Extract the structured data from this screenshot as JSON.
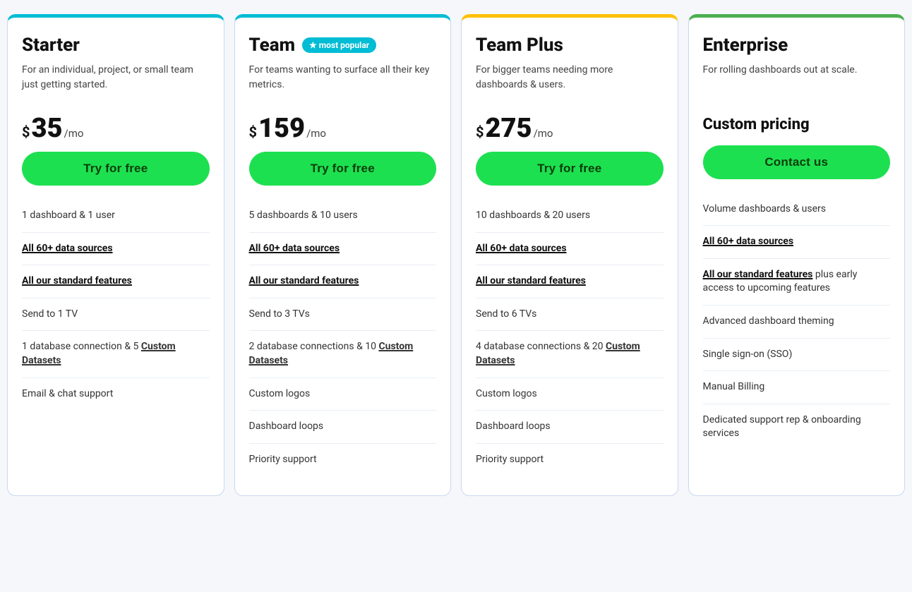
{
  "plans": [
    {
      "id": "starter",
      "name": "Starter",
      "badge": null,
      "description": "For an individual, project, or small team just getting started.",
      "price": "35",
      "period": "/mo",
      "cta": "Try for free",
      "cardClass": "starter",
      "features": [
        {
          "text": "1 dashboard & 1 user",
          "type": "plain"
        },
        {
          "text": "All 60+ data sources",
          "type": "link"
        },
        {
          "text": "All our standard features",
          "type": "link"
        },
        {
          "text": "Send to 1 TV",
          "type": "plain"
        },
        {
          "prefix": "1 database connection & 5 ",
          "bold": "Custom Datasets",
          "type": "mixed"
        },
        {
          "text": "Email & chat support",
          "type": "plain"
        }
      ]
    },
    {
      "id": "team",
      "name": "Team",
      "badge": "★ most popular",
      "description": "For teams wanting to surface all their key metrics.",
      "price": "159",
      "period": "/mo",
      "cta": "Try for free",
      "cardClass": "team",
      "features": [
        {
          "text": "5 dashboards & 10 users",
          "type": "plain"
        },
        {
          "text": "All 60+ data sources",
          "type": "link"
        },
        {
          "text": "All our standard features",
          "type": "link"
        },
        {
          "text": "Send to 3 TVs",
          "type": "plain"
        },
        {
          "prefix": "2 database connections & 10 ",
          "bold": "Custom Datasets",
          "type": "mixed"
        },
        {
          "text": "Custom logos",
          "type": "plain"
        },
        {
          "text": "Dashboard loops",
          "type": "plain"
        },
        {
          "text": "Priority support",
          "type": "plain"
        }
      ]
    },
    {
      "id": "team-plus",
      "name": "Team Plus",
      "badge": null,
      "description": "For bigger teams needing more dashboards & users.",
      "price": "275",
      "period": "/mo",
      "cta": "Try for free",
      "cardClass": "team-plus",
      "features": [
        {
          "text": "10 dashboards & 20 users",
          "type": "plain"
        },
        {
          "text": "All 60+ data sources",
          "type": "link"
        },
        {
          "text": "All our standard features",
          "type": "link"
        },
        {
          "text": "Send to 6 TVs",
          "type": "plain"
        },
        {
          "prefix": "4 database connections & 20 ",
          "bold": "Custom Datasets",
          "type": "mixed"
        },
        {
          "text": "Custom logos",
          "type": "plain"
        },
        {
          "text": "Dashboard loops",
          "type": "plain"
        },
        {
          "text": "Priority support",
          "type": "plain"
        }
      ]
    },
    {
      "id": "enterprise",
      "name": "Enterprise",
      "badge": null,
      "description": "For rolling dashboards out at scale.",
      "price": null,
      "customPricing": "Custom pricing",
      "period": null,
      "cta": "Contact us",
      "cardClass": "enterprise",
      "features": [
        {
          "text": "Volume dashboards & users",
          "type": "plain"
        },
        {
          "text": "All 60+ data sources",
          "type": "link"
        },
        {
          "linkPart": "All our standard features",
          "suffix": " plus early access to upcoming features",
          "type": "link-plus"
        },
        {
          "text": "Advanced dashboard theming",
          "type": "plain"
        },
        {
          "text": "Single sign-on (SSO)",
          "type": "plain"
        },
        {
          "text": "Manual Billing",
          "type": "plain"
        },
        {
          "text": "Dedicated support rep & onboarding services",
          "type": "plain"
        }
      ]
    }
  ]
}
